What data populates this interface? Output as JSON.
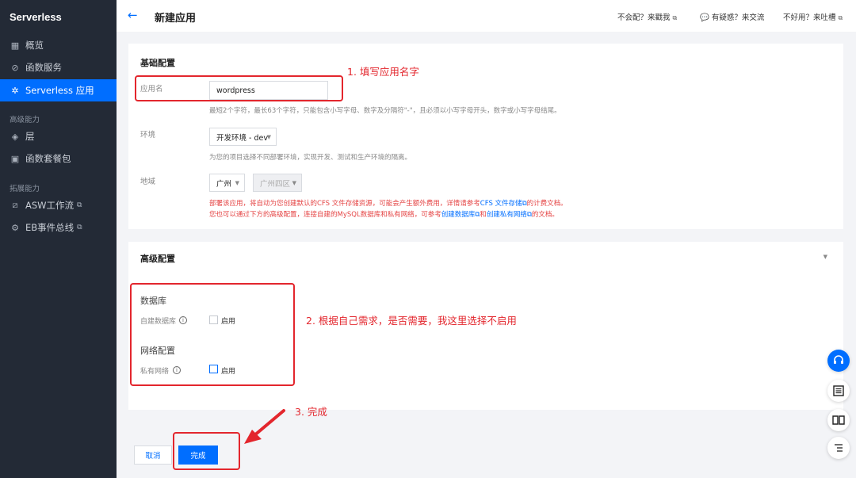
{
  "sidebar": {
    "brand": "Serverless",
    "items": [
      {
        "label": "概览",
        "icon": "grid-icon"
      },
      {
        "label": "函数服务",
        "icon": "function-icon"
      },
      {
        "label": "Serverless 应用",
        "icon": "app-icon",
        "active": true
      }
    ],
    "group_advanced": "高级能力",
    "advanced_items": [
      {
        "label": "层",
        "icon": "layers-icon"
      },
      {
        "label": "函数套餐包",
        "icon": "package-icon"
      }
    ],
    "group_extension": "拓展能力",
    "extension_items": [
      {
        "label": "ASW工作流",
        "icon": "workflow-icon",
        "external": true
      },
      {
        "label": "EB事件总线",
        "icon": "eventbus-icon",
        "external": true
      }
    ]
  },
  "header": {
    "title": "新建应用",
    "links": [
      "不会配？来戳我",
      "有疑惑？来交流",
      "不好用？来吐槽"
    ]
  },
  "basic": {
    "title": "基础配置",
    "app_name_label": "应用名",
    "app_name_value": "wordpress",
    "app_name_hint": "最短2个字符，最长63个字符，只能包含小写字母、数字及分隔符\"-\"，且必须以小写字母开头，数字或小写字母结尾。",
    "env_label": "环境",
    "env_value": "开发环境 - dev",
    "env_hint": "为您的项目选择不同部署环境，实现开发、测试和生产环境的隔离。",
    "region_label": "地域",
    "region_value": "广州",
    "zone_value": "广州四区",
    "warn_line1_a": "部署该应用，将自动为您创建默认的CFS 文件存储资源，可能会产生额外费用，详情请参考",
    "warn_line1_link": "CFS 文件存储",
    "warn_line1_b": "的计费文档。",
    "warn_line2_a": "您也可以通过下方的高级配置，连接自建的MySQL数据库和私有网络，可参考",
    "warn_line2_link1": "创建数据库",
    "warn_line2_mid": "和",
    "warn_line2_link2": "创建私有网络",
    "warn_line2_b": "的文档。"
  },
  "advanced": {
    "title": "高级配置",
    "db_section": "数据库",
    "db_label": "自建数据库",
    "db_option": "启用",
    "net_section": "网络配置",
    "net_label": "私有网络",
    "net_option": "启用"
  },
  "annotations": {
    "step1": "1. 填写应用名字",
    "step2": "2. 根据自己需求，是否需要，我这里选择不启用",
    "step3": "3. 完成"
  },
  "footer": {
    "cancel": "取消",
    "done": "完成"
  },
  "colors": {
    "primary": "#006eff",
    "sidebar_bg": "#232a36",
    "annotation_red": "#e3262d"
  }
}
